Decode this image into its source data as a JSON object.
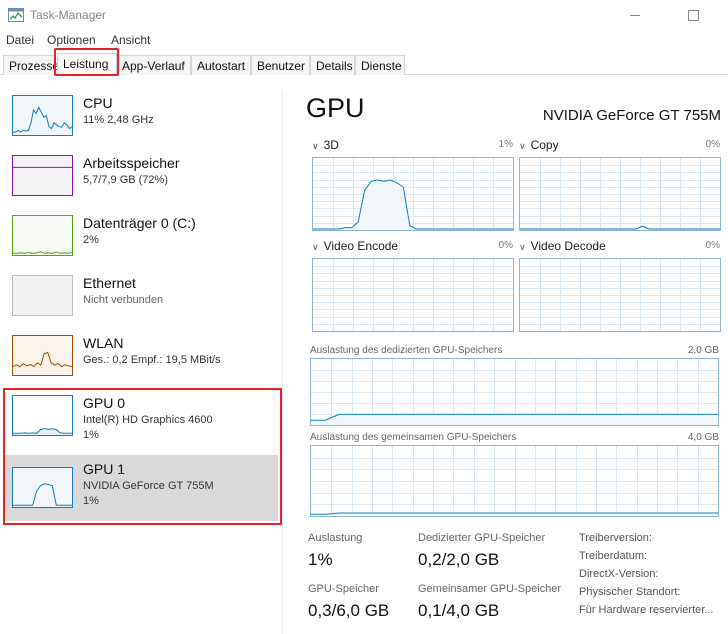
{
  "window": {
    "title": "Task-Manager",
    "icon": "task-manager-icon"
  },
  "menu": [
    "Datei",
    "Optionen",
    "Ansicht"
  ],
  "tabs": [
    {
      "label": "Prozesse",
      "active": false
    },
    {
      "label": "Leistung",
      "active": true
    },
    {
      "label": "App-Verlauf",
      "active": false
    },
    {
      "label": "Autostart",
      "active": false
    },
    {
      "label": "Benutzer",
      "active": false
    },
    {
      "label": "Details",
      "active": false
    },
    {
      "label": "Dienste",
      "active": false
    }
  ],
  "sidebar": {
    "items": [
      {
        "name": "CPU",
        "line1": "11% 2,48 GHz",
        "line2": "",
        "accent": "#117dbb",
        "fill": "#f1f6fa",
        "selected": false,
        "spark": [
          0.05,
          0.05,
          0.1,
          0.05,
          0.1,
          0.08,
          0.1,
          0.3,
          0.65,
          0.55,
          0.72,
          0.6,
          0.45,
          0.5,
          0.2,
          0.15,
          0.3,
          0.25,
          0.2,
          0.18,
          0.3,
          0.25,
          0.15,
          0.2
        ]
      },
      {
        "name": "Arbeitsspeicher",
        "line1": "5,7/7,9 GB (72%)",
        "line2": "",
        "accent": "#8b12ae",
        "fill": "#f4f2f4",
        "selected": false,
        "spark": [
          0.72,
          0.72,
          0.72,
          0.72,
          0.72,
          0.72,
          0.72,
          0.72,
          0.72,
          0.72,
          0.72,
          0.72
        ]
      },
      {
        "name": "Datenträger 0 (C:)",
        "line1": "2%",
        "line2": "",
        "accent": "#4da60c",
        "fill": "#f8fbf5",
        "selected": false,
        "spark": [
          0.02,
          0.02,
          0.03,
          0.02,
          0.04,
          0.02,
          0.03,
          0.06,
          0.02,
          0.03,
          0.02,
          0.05,
          0.02,
          0.03,
          0.02,
          0.04
        ]
      },
      {
        "name": "Ethernet",
        "line1": "Nicht verbunden",
        "line2": "",
        "accent": "#bdbdbd",
        "fill": "#f2f2f2",
        "selected": false,
        "spark": []
      },
      {
        "name": "WLAN",
        "line1": "Ges.: 0,2  Empf.: 19,5 MBit/s",
        "line2": "",
        "accent": "#a74f01",
        "fill": "#fcf3eb",
        "selected": false,
        "spark": [
          0.2,
          0.25,
          0.2,
          0.28,
          0.22,
          0.26,
          0.2,
          0.3,
          0.24,
          0.55,
          0.58,
          0.3,
          0.24,
          0.28,
          0.2,
          0.25,
          0.22,
          0.2
        ]
      },
      {
        "name": "GPU 0",
        "line1": "Intel(R) HD Graphics 4600",
        "line2": "1%",
        "accent": "#117dbb",
        "fill": "#ffffff",
        "selected": false,
        "spark": [
          0.02,
          0.02,
          0.02,
          0.03,
          0.02,
          0.03,
          0.02,
          0.12,
          0.15,
          0.13,
          0.14,
          0.12,
          0.03,
          0.02,
          0.02,
          0.02
        ]
      },
      {
        "name": "GPU 1",
        "line1": "NVIDIA GeForce GT 755M",
        "line2": "1%",
        "accent": "#117dbb",
        "fill": "#f1f6fa",
        "selected": true,
        "spark": [
          0.02,
          0.02,
          0.02,
          0.02,
          0.02,
          0.02,
          0.4,
          0.55,
          0.6,
          0.58,
          0.55,
          0.02,
          0.02,
          0.02,
          0.02,
          0.02
        ]
      }
    ]
  },
  "gpu": {
    "title": "GPU",
    "model": "NVIDIA GeForce GT 755M",
    "engines": [
      {
        "label": "3D",
        "percent": "1%",
        "spark": [
          0.0,
          0.0,
          0.0,
          0.0,
          0.0,
          0.02,
          0.02,
          0.1,
          0.55,
          0.68,
          0.7,
          0.68,
          0.7,
          0.66,
          0.6,
          0.05,
          0.0,
          0.0,
          0.0,
          0.0,
          0.0,
          0.0,
          0.0,
          0.0,
          0.0,
          0.0,
          0.0,
          0.0,
          0.0,
          0.0,
          0.0,
          0.0
        ]
      },
      {
        "label": "Copy",
        "percent": "0%",
        "spark": [
          0.0,
          0.0,
          0.0,
          0.0,
          0.0,
          0.0,
          0.0,
          0.0,
          0.0,
          0.0,
          0.0,
          0.0,
          0.0,
          0.0,
          0.0,
          0.0,
          0.0,
          0.0,
          0.0,
          0.04,
          0.0,
          0.0,
          0.0,
          0.0,
          0.0,
          0.0,
          0.0,
          0.0,
          0.0,
          0.0,
          0.0,
          0.0
        ]
      },
      {
        "label": "Video Encode",
        "percent": "0%",
        "spark": []
      },
      {
        "label": "Video Decode",
        "percent": "0%",
        "spark": []
      }
    ],
    "dedicated_memory": {
      "label": "Auslastung des dedizierten GPU-Speichers",
      "max": "2,0 GB",
      "fraction": 0.15
    },
    "shared_memory": {
      "label": "Auslastung des gemeinsamen GPU-Speichers",
      "max": "4,0 GB",
      "fraction": 0.03
    },
    "stats": [
      {
        "label": "Auslastung",
        "value": "1%"
      },
      {
        "label": "Dedizierter GPU-Speicher",
        "value": "0,2/2,0 GB"
      },
      {
        "label": "GPU-Speicher",
        "value": "0,3/6,0 GB"
      },
      {
        "label": "Gemeinsamer GPU-Speicher",
        "value": "0,1/4,0 GB"
      }
    ],
    "info_labels": [
      "Treiberversion:",
      "Treiberdatum:",
      "DirectX-Version:",
      "Physischer Standort:",
      "Für Hardware reservierter..."
    ]
  }
}
